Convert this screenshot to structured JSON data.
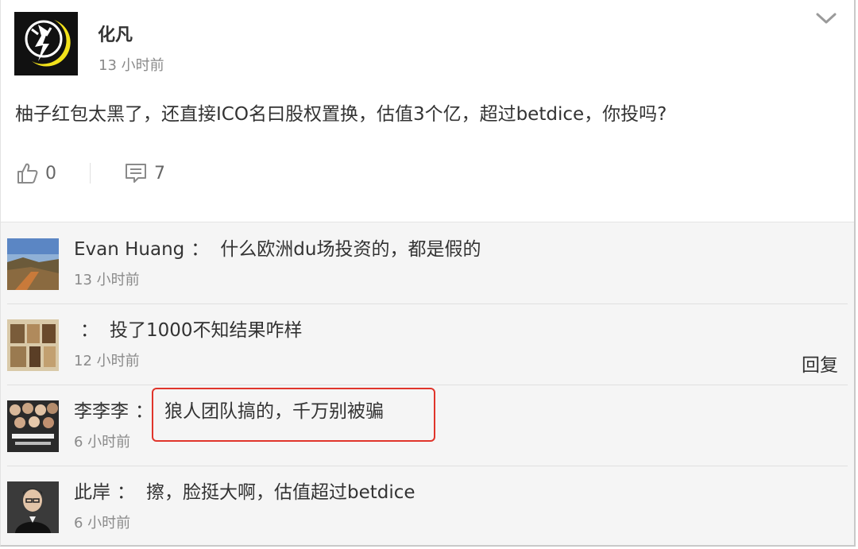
{
  "post": {
    "author": "化凡",
    "time": "13 小时前",
    "text": "柚子红包太黑了，还直接ICO名曰股权置换，估值3个亿，超过betdice，你投吗?",
    "likes": "0",
    "comments_count": "7"
  },
  "comments": [
    {
      "user": "Evan Huang",
      "colon": "：",
      "text": "什么欧洲du场投资的，都是假的",
      "time": "13 小时前"
    },
    {
      "user": "",
      "colon": "：",
      "text": "投了1000不知结果咋样",
      "time": "12 小时前",
      "reply_label": "回复"
    },
    {
      "user": "李李李",
      "colon": "：",
      "text": "狼人团队搞的，千万别被骗",
      "time": "6 小时前"
    },
    {
      "user": "此岸",
      "colon": "：",
      "text": "擦，脸挺大啊，估值超过betdice",
      "time": "6 小时前"
    }
  ],
  "colors": {
    "highlight": "#e0352b",
    "comment_bg": "#f5f5f5",
    "muted_text": "#8a8a8a"
  },
  "icons": {
    "like": "thumbs-up-icon",
    "comment": "comment-icon",
    "expand": "chevron-down-icon"
  }
}
